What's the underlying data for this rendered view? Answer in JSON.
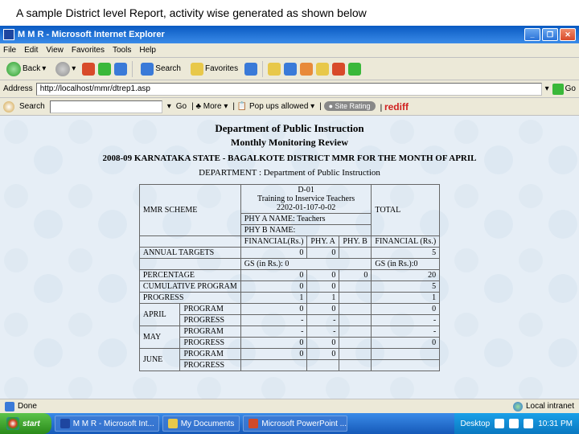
{
  "caption": "A sample District level Report, activity wise generated as shown below",
  "window": {
    "title": "M M R - Microsoft Internet Explorer"
  },
  "menu": {
    "items": [
      "File",
      "Edit",
      "View",
      "Favorites",
      "Tools",
      "Help"
    ]
  },
  "toolbar": {
    "back": "Back",
    "search": "Search",
    "favorites": "Favorites"
  },
  "address": {
    "label": "Address",
    "url": "http://localhost/mmr/dtrep1.asp",
    "go": "Go"
  },
  "searchbar": {
    "label": "Search",
    "go": "Go",
    "more": "More",
    "popups": "Pop ups allowed",
    "rating": "Site Rating",
    "brand": "rediff"
  },
  "report": {
    "h1": "Department of Public Instruction",
    "h2": "Monthly Monitoring Review",
    "h3": "2008-09 KARNATAKA STATE - BAGALKOTE DISTRICT MMR FOR THE MONTH OF APRIL",
    "dept_label": "DEPARTMENT :",
    "dept_value": "Department of Public Instruction",
    "col_head_code": "D-01",
    "col_head_desc": "Training to Inservice Teachers",
    "col_head_num": "2202-01-107-0-02",
    "mmr_scheme": "MMR SCHEME",
    "total": "TOTAL",
    "phy_a_name": "PHY A NAME: Teachers",
    "phy_b_name": "PHY B NAME:",
    "fin_rs": "FINANCIAL(Rs.)",
    "phy_a": "PHY. A",
    "phy_b": "PHY. B",
    "fin_rs_total": "FINANCIAL (Rs.)",
    "rows": {
      "annual": {
        "label": "ANNUAL TARGETS",
        "v1": "0",
        "v2": "0",
        "v3": "",
        "v4": "5"
      },
      "gs": {
        "left": "GS (in Rs.): 0",
        "right": "GS (in Rs.):0"
      },
      "percentage": {
        "label": "PERCENTAGE",
        "v1": "0",
        "v2": "0",
        "v3": "0",
        "v4": "20"
      },
      "cumprog": {
        "label": "CUMULATIVE PROGRAM",
        "v1": "0",
        "v2": "0",
        "v3": "",
        "v4": "5"
      },
      "progress": {
        "label": "PROGRESS",
        "v1": "1",
        "v2": "1",
        "v3": "",
        "v4": "1"
      },
      "april": {
        "label": "APRIL",
        "program": "PROGRAM",
        "pv": [
          "0",
          "0",
          "",
          "0"
        ],
        "progress": "PROGRESS",
        "gv": [
          "-",
          "-",
          "",
          "-"
        ]
      },
      "may": {
        "label": "MAY",
        "program": "PROGRAM",
        "pv": [
          "-",
          "-",
          "",
          "-"
        ],
        "progress": "PROGRESS",
        "gv": [
          "0",
          "0",
          "",
          "0"
        ]
      },
      "june": {
        "label": "JUNE",
        "program": "PROGRAM",
        "pv": [
          "0",
          "0",
          "",
          ""
        ],
        "progress": "PROGRESS"
      }
    }
  },
  "status": {
    "done": "Done",
    "zone": "Local intranet"
  },
  "taskbar": {
    "start": "start",
    "tasks": [
      "M M R - Microsoft Int...",
      "My Documents",
      "Microsoft PowerPoint ..."
    ],
    "desktop": "Desktop",
    "clock": "10:31 PM"
  }
}
